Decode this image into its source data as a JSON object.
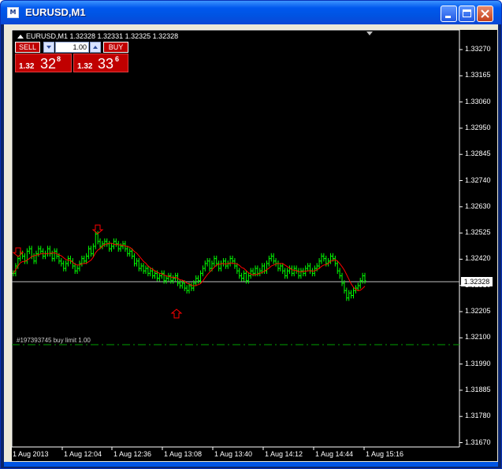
{
  "window": {
    "title": "EURUSD,M1",
    "app_icon_text": "M"
  },
  "chart": {
    "info": "EURUSD,M1  1.32328 1.32331 1.32325 1.32328",
    "current_price": "1.32328",
    "order_label": "#197393745 buy limit 1.00",
    "price_ticks": [
      "1.33270",
      "1.33165",
      "1.33060",
      "1.32950",
      "1.32845",
      "1.32740",
      "1.32630",
      "1.32525",
      "1.32420",
      "1.32310",
      "1.32205",
      "1.32100",
      "1.31990",
      "1.31885",
      "1.31780",
      "1.31670"
    ],
    "time_labels": [
      "1 Aug 2013",
      "1 Aug 12:04",
      "1 Aug 12:36",
      "1 Aug 13:08",
      "1 Aug 13:40",
      "1 Aug 14:12",
      "1 Aug 14:44",
      "1 Aug 15:16"
    ],
    "colors": {
      "background": "#000000",
      "bars": "#00ff00",
      "moving_average": "#ff0000",
      "order_line": "#00a000",
      "price_line": "#c0c0c0",
      "arrows": "#ff0000"
    }
  },
  "trade_panel": {
    "sell_label": "SELL",
    "buy_label": "BUY",
    "volume": "1.00",
    "sell_price": {
      "prefix": "1.32",
      "big": "32",
      "sup": "8"
    },
    "buy_price": {
      "prefix": "1.32",
      "big": "33",
      "sup": "6"
    }
  },
  "chart_data": {
    "type": "ohlc",
    "symbol": "EURUSD",
    "timeframe": "M1",
    "ylim": [
      1.3162,
      1.3332
    ],
    "x_start": "1 Aug 2013",
    "x_end": "1 Aug 15:16",
    "close": [
      1.3236,
      1.3239,
      1.3242,
      1.3244,
      1.3243,
      1.3241,
      1.3245,
      1.3246,
      1.3243,
      1.3241,
      1.3244,
      1.3246,
      1.3245,
      1.3243,
      1.3244,
      1.3246,
      1.3244,
      1.3242,
      1.3245,
      1.3243,
      1.3241,
      1.324,
      1.3238,
      1.324,
      1.3242,
      1.3241,
      1.3239,
      1.3237,
      1.3238,
      1.324,
      1.3242,
      1.3241,
      1.3243,
      1.3246,
      1.3244,
      1.3247,
      1.3252,
      1.3249,
      1.3247,
      1.3248,
      1.3249,
      1.3248,
      1.3246,
      1.3247,
      1.3249,
      1.3248,
      1.3246,
      1.3247,
      1.3248,
      1.3246,
      1.3244,
      1.3245,
      1.3243,
      1.324,
      1.3241,
      1.3238,
      1.3239,
      1.3237,
      1.3238,
      1.3236,
      1.3237,
      1.3235,
      1.3236,
      1.3234,
      1.3235,
      1.3236,
      1.3233,
      1.3234,
      1.3235,
      1.3233,
      1.3234,
      1.3235,
      1.3232,
      1.3231,
      1.3232,
      1.323,
      1.3229,
      1.3231,
      1.323,
      1.3232,
      1.3234,
      1.3233,
      1.3236,
      1.3238,
      1.324,
      1.3241,
      1.3238,
      1.324,
      1.3242,
      1.324,
      1.3238,
      1.324,
      1.3241,
      1.3239,
      1.324,
      1.3242,
      1.3241,
      1.3239,
      1.3237,
      1.3235,
      1.3234,
      1.3236,
      1.3233,
      1.3235,
      1.3237,
      1.3236,
      1.3238,
      1.3236,
      1.3237,
      1.3239,
      1.3237,
      1.324,
      1.3242,
      1.3243,
      1.3241,
      1.324,
      1.3238,
      1.3239,
      1.3237,
      1.3235,
      1.3237,
      1.3238,
      1.3236,
      1.3238,
      1.3237,
      1.3235,
      1.3237,
      1.3236,
      1.3238,
      1.3239,
      1.3237,
      1.3236,
      1.3238,
      1.3239,
      1.3241,
      1.3243,
      1.3242,
      1.324,
      1.3241,
      1.3243,
      1.3242,
      1.324,
      1.3237,
      1.3235,
      1.3232,
      1.3229,
      1.3226,
      1.3228,
      1.3227,
      1.3229,
      1.323,
      1.3231,
      1.3233,
      1.3235,
      1.3233
    ]
  }
}
